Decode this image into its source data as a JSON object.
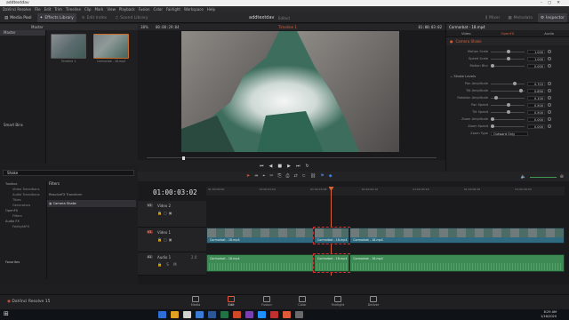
{
  "window": {
    "title": "addtextdav"
  },
  "menu": [
    "DaVinci Resolve",
    "File",
    "Edit",
    "Trim",
    "Timeline",
    "Clip",
    "Mark",
    "View",
    "Playback",
    "Fusion",
    "Color",
    "Fairlight",
    "Workspace",
    "Help"
  ],
  "toolbar": {
    "media_pool": "Media Pool",
    "effects_library": "Effects Library",
    "edit_index": "Edit Index",
    "sound_library": "Sound Library",
    "project_title": "addtextdav",
    "edited": "Edited",
    "mixer": "Mixer",
    "metadata": "Metadata",
    "inspector": "Inspector"
  },
  "media_pool": {
    "bin_header": "Master",
    "bins": [
      "Master"
    ],
    "smart_bins": "Smart Bins",
    "clips": [
      {
        "label": "Timeline 1"
      },
      {
        "label": "Cormorbat - 18.mp4"
      }
    ]
  },
  "viewer": {
    "zoom": "38%",
    "source_tc": "00:00:29:04",
    "timeline_name": "Timeline 1",
    "record_tc": "01:00:03:02"
  },
  "effects": {
    "search_value": "Shake",
    "tree": [
      {
        "label": "Toolbox",
        "level": 0
      },
      {
        "label": "Video Transitions",
        "level": 1
      },
      {
        "label": "Audio Transitions",
        "level": 1
      },
      {
        "label": "Titles",
        "level": 1
      },
      {
        "label": "Generators",
        "level": 1
      },
      {
        "label": "OpenFX",
        "level": 0
      },
      {
        "label": "Filters",
        "level": 1
      },
      {
        "label": "Audio FX",
        "level": 0
      },
      {
        "label": "FairlightFX",
        "level": 1
      }
    ],
    "favorites": "Favorites",
    "filters_header": "Filters",
    "results": [
      "ResolveFX Transform",
      "Camera Shake"
    ]
  },
  "inspector": {
    "clip_name": "Cormorbat - 18.mp4",
    "tabs": [
      "Video",
      "OpenFX",
      "Audio"
    ],
    "active_tab": "OpenFX",
    "effect_name": "Camera Shake",
    "motion_rows": [
      {
        "label": "Motion Scale",
        "value": "1.000",
        "fill": 0.5
      },
      {
        "label": "Speed Scale",
        "value": "1.000",
        "fill": 0.5
      },
      {
        "label": "Motion Blur",
        "value": "0.000",
        "fill": 0.0
      }
    ],
    "section_shake": "Shake Levels",
    "shake_rows": [
      {
        "label": "Pan Amplitude",
        "value": "0.703",
        "fill": 0.7
      },
      {
        "label": "Tilt Amplitude",
        "value": "0.890",
        "fill": 0.88
      },
      {
        "label": "Rotation Amplitude",
        "value": "0.100",
        "fill": 0.1
      },
      {
        "label": "Pan Speed",
        "value": "0.500",
        "fill": 0.5
      },
      {
        "label": "Tilt Speed",
        "value": "0.500",
        "fill": 0.5
      },
      {
        "label": "Zoom Amplitude",
        "value": "0.000",
        "fill": 0.0
      },
      {
        "label": "Zoom Speed",
        "value": "0.000",
        "fill": 0.0
      }
    ],
    "zoom_mode_label": "Zoom Type",
    "zoom_mode_value": "Outward Only"
  },
  "timeline": {
    "timecode": "01:00:03:02",
    "ruler_ticks": [
      "01:00:00:00",
      "01:00:01:04",
      "01:00:03:08",
      "01:00:04:12",
      "01:00:05:16",
      "01:00:06:20",
      "01:00:08:00"
    ],
    "tracks": [
      {
        "badge": "V2",
        "name": "Video 2"
      },
      {
        "badge": "V1",
        "name": "Video 1"
      },
      {
        "badge": "A1",
        "name": "Audio 1",
        "level": "2.0"
      }
    ],
    "video_clips": [
      "Cormorbat - 18.mp4",
      "Cormorbat - 18.mp4",
      "Cormorbat - 18.mp4"
    ],
    "audio_clips": [
      "Cormorbat - 18.mp4",
      "Cormorbat - 18.mp4",
      "Cormorbat - 18.mp4"
    ],
    "clip_split_fractions": [
      0,
      0.3,
      0.4,
      1
    ]
  },
  "pages": [
    "Media",
    "Edit",
    "Fusion",
    "Color",
    "Fairlight",
    "Deliver"
  ],
  "active_page": "Edit",
  "app_name": "DaVinci Resolve 15",
  "taskbar": {
    "time": "8:29 AM",
    "date": "1/16/2020"
  }
}
